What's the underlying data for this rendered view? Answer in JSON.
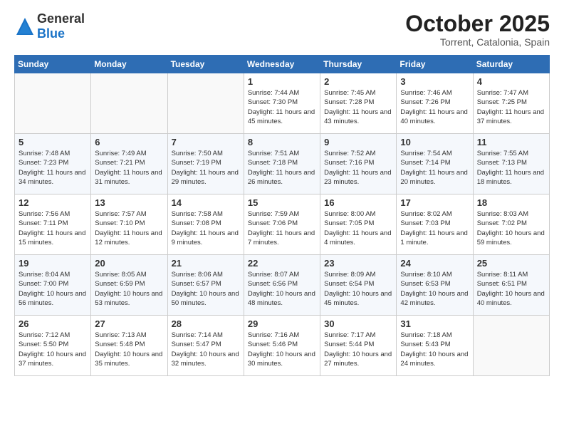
{
  "header": {
    "logo_general": "General",
    "logo_blue": "Blue",
    "month": "October 2025",
    "location": "Torrent, Catalonia, Spain"
  },
  "days_of_week": [
    "Sunday",
    "Monday",
    "Tuesday",
    "Wednesday",
    "Thursday",
    "Friday",
    "Saturday"
  ],
  "weeks": [
    {
      "days": [
        {
          "num": "",
          "info": ""
        },
        {
          "num": "",
          "info": ""
        },
        {
          "num": "",
          "info": ""
        },
        {
          "num": "1",
          "info": "Sunrise: 7:44 AM\nSunset: 7:30 PM\nDaylight: 11 hours and 45 minutes."
        },
        {
          "num": "2",
          "info": "Sunrise: 7:45 AM\nSunset: 7:28 PM\nDaylight: 11 hours and 43 minutes."
        },
        {
          "num": "3",
          "info": "Sunrise: 7:46 AM\nSunset: 7:26 PM\nDaylight: 11 hours and 40 minutes."
        },
        {
          "num": "4",
          "info": "Sunrise: 7:47 AM\nSunset: 7:25 PM\nDaylight: 11 hours and 37 minutes."
        }
      ]
    },
    {
      "days": [
        {
          "num": "5",
          "info": "Sunrise: 7:48 AM\nSunset: 7:23 PM\nDaylight: 11 hours and 34 minutes."
        },
        {
          "num": "6",
          "info": "Sunrise: 7:49 AM\nSunset: 7:21 PM\nDaylight: 11 hours and 31 minutes."
        },
        {
          "num": "7",
          "info": "Sunrise: 7:50 AM\nSunset: 7:19 PM\nDaylight: 11 hours and 29 minutes."
        },
        {
          "num": "8",
          "info": "Sunrise: 7:51 AM\nSunset: 7:18 PM\nDaylight: 11 hours and 26 minutes."
        },
        {
          "num": "9",
          "info": "Sunrise: 7:52 AM\nSunset: 7:16 PM\nDaylight: 11 hours and 23 minutes."
        },
        {
          "num": "10",
          "info": "Sunrise: 7:54 AM\nSunset: 7:14 PM\nDaylight: 11 hours and 20 minutes."
        },
        {
          "num": "11",
          "info": "Sunrise: 7:55 AM\nSunset: 7:13 PM\nDaylight: 11 hours and 18 minutes."
        }
      ]
    },
    {
      "days": [
        {
          "num": "12",
          "info": "Sunrise: 7:56 AM\nSunset: 7:11 PM\nDaylight: 11 hours and 15 minutes."
        },
        {
          "num": "13",
          "info": "Sunrise: 7:57 AM\nSunset: 7:10 PM\nDaylight: 11 hours and 12 minutes."
        },
        {
          "num": "14",
          "info": "Sunrise: 7:58 AM\nSunset: 7:08 PM\nDaylight: 11 hours and 9 minutes."
        },
        {
          "num": "15",
          "info": "Sunrise: 7:59 AM\nSunset: 7:06 PM\nDaylight: 11 hours and 7 minutes."
        },
        {
          "num": "16",
          "info": "Sunrise: 8:00 AM\nSunset: 7:05 PM\nDaylight: 11 hours and 4 minutes."
        },
        {
          "num": "17",
          "info": "Sunrise: 8:02 AM\nSunset: 7:03 PM\nDaylight: 11 hours and 1 minute."
        },
        {
          "num": "18",
          "info": "Sunrise: 8:03 AM\nSunset: 7:02 PM\nDaylight: 10 hours and 59 minutes."
        }
      ]
    },
    {
      "days": [
        {
          "num": "19",
          "info": "Sunrise: 8:04 AM\nSunset: 7:00 PM\nDaylight: 10 hours and 56 minutes."
        },
        {
          "num": "20",
          "info": "Sunrise: 8:05 AM\nSunset: 6:59 PM\nDaylight: 10 hours and 53 minutes."
        },
        {
          "num": "21",
          "info": "Sunrise: 8:06 AM\nSunset: 6:57 PM\nDaylight: 10 hours and 50 minutes."
        },
        {
          "num": "22",
          "info": "Sunrise: 8:07 AM\nSunset: 6:56 PM\nDaylight: 10 hours and 48 minutes."
        },
        {
          "num": "23",
          "info": "Sunrise: 8:09 AM\nSunset: 6:54 PM\nDaylight: 10 hours and 45 minutes."
        },
        {
          "num": "24",
          "info": "Sunrise: 8:10 AM\nSunset: 6:53 PM\nDaylight: 10 hours and 42 minutes."
        },
        {
          "num": "25",
          "info": "Sunrise: 8:11 AM\nSunset: 6:51 PM\nDaylight: 10 hours and 40 minutes."
        }
      ]
    },
    {
      "days": [
        {
          "num": "26",
          "info": "Sunrise: 7:12 AM\nSunset: 5:50 PM\nDaylight: 10 hours and 37 minutes."
        },
        {
          "num": "27",
          "info": "Sunrise: 7:13 AM\nSunset: 5:48 PM\nDaylight: 10 hours and 35 minutes."
        },
        {
          "num": "28",
          "info": "Sunrise: 7:14 AM\nSunset: 5:47 PM\nDaylight: 10 hours and 32 minutes."
        },
        {
          "num": "29",
          "info": "Sunrise: 7:16 AM\nSunset: 5:46 PM\nDaylight: 10 hours and 30 minutes."
        },
        {
          "num": "30",
          "info": "Sunrise: 7:17 AM\nSunset: 5:44 PM\nDaylight: 10 hours and 27 minutes."
        },
        {
          "num": "31",
          "info": "Sunrise: 7:18 AM\nSunset: 5:43 PM\nDaylight: 10 hours and 24 minutes."
        },
        {
          "num": "",
          "info": ""
        }
      ]
    }
  ]
}
